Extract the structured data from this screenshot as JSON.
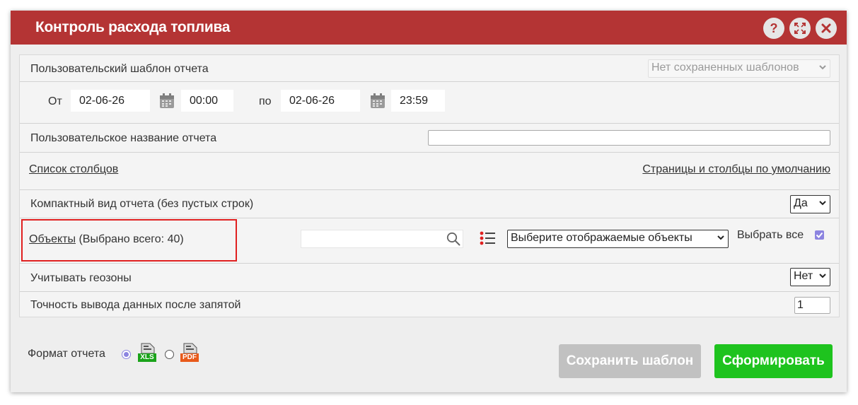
{
  "title": "Контроль расхода топлива",
  "titlebar_buttons": {
    "help": "?"
  },
  "template": {
    "label": "Пользовательский шаблон отчета",
    "select_value": "Нет сохраненных шаблонов"
  },
  "period": {
    "from_label": "От",
    "from_date": "02-06-26",
    "from_time": "00:00",
    "to_label": "по",
    "to_date": "02-06-26",
    "to_time": "23:59"
  },
  "report_name": {
    "label": "Пользовательское название отчета",
    "value": ""
  },
  "columns": {
    "link": "Список столбцов",
    "defaults_link": "Страницы и столбцы по умолчанию"
  },
  "compact": {
    "label": "Компактный вид отчета (без пустых строк)",
    "value": "Да"
  },
  "objects": {
    "link": "Объекты",
    "count_text": "(Выбрано всего: 40)",
    "search_value": "",
    "display_select": "Выберите отображаемые объекты",
    "select_all_label": "Выбрать все",
    "select_all_checked": true
  },
  "geozones": {
    "label": "Учитывать геозоны",
    "value": "Нет"
  },
  "precision": {
    "label": "Точность вывода данных после запятой",
    "value": "1"
  },
  "format": {
    "label": "Формат отчета",
    "xls_text": "XLS",
    "pdf_text": "PDF",
    "selected": "xls"
  },
  "buttons": {
    "save_template": "Сохранить шаблон",
    "generate": "Сформировать"
  },
  "colors": {
    "titlebar": "#b43434",
    "highlight": "#e02020",
    "generate": "#1ec31e",
    "save_disabled": "#c1c1c1",
    "checkbox": "#8c84e0"
  }
}
